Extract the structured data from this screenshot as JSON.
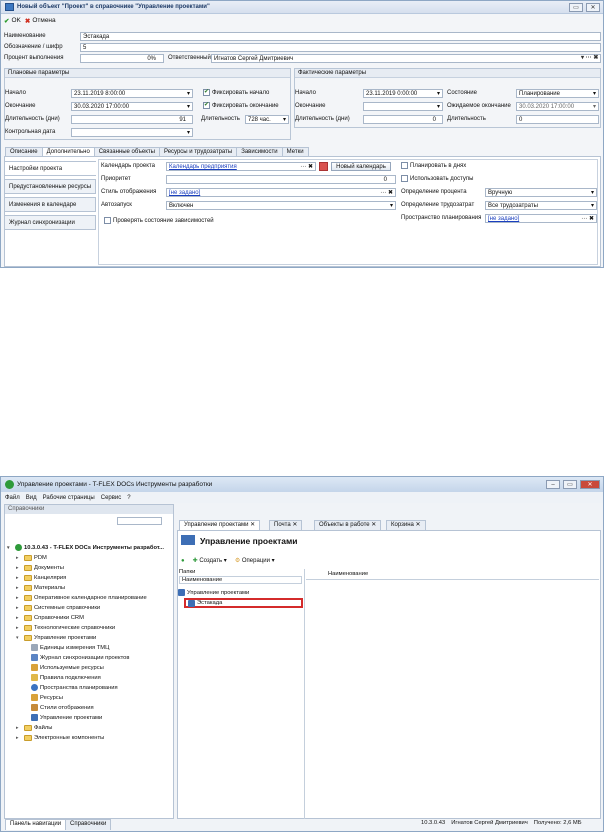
{
  "dialog": {
    "title": "Новый объект \"Проект\" в справочнике \"Управление проектами\"",
    "ok": "OK",
    "cancel": "Отмена",
    "name_label": "Наименование",
    "name_value": "Эстакада",
    "code_label": "Обозначение / шифр",
    "code_value": "5",
    "percent_label": "Процент выполнения",
    "percent_value": "0%",
    "resp_label": "Ответственный",
    "resp_value": "Игнатов Сергей Дмитриевич",
    "planned": {
      "title": "Плановые параметры",
      "start_label": "Начало",
      "start": "23.11.2019 8:00:00",
      "end_label": "Окончание",
      "end": "30.03.2020 17:00:00",
      "dur_label": "Длительность (дни)",
      "dur": "91",
      "ctrl_label": "Контрольная дата",
      "fix_start": "Фиксировать начало",
      "fix_end": "Фиксировать окончание",
      "len_label": "Длительность",
      "len": "728 час."
    },
    "actual": {
      "title": "Фактические параметры",
      "start_label": "Начало",
      "start": "23.11.2019 0:00:00",
      "end_label": "Окончание",
      "dur_label": "Длительность (дни)",
      "dur": "0",
      "state_label": "Состояние",
      "state": "Планирование",
      "exp_end_label": "Ожидаемое окончание",
      "exp_end": "30.03.2020 17:00:00",
      "len_label": "Длительность",
      "len": "0"
    },
    "tabs": [
      "Описание",
      "Дополнительно",
      "Связанные объекты",
      "Ресурсы и трудозатраты",
      "Зависимости",
      "Метки"
    ],
    "side": [
      "Настройки проекта",
      "Предустановленные ресурсы",
      "Изменения в календаре",
      "Журнал синхронизации"
    ],
    "extra": {
      "cal_label": "Календарь проекта",
      "cal": "Календарь предприятия",
      "new_cal": "Новый календарь",
      "prio_label": "Приоритет",
      "prio": "0",
      "style_label": "Стиль отображения",
      "style": "[не задано]",
      "auto_label": "Автозапуск",
      "auto": "Включен",
      "check_deps": "Проверять состояние зависимостей",
      "plan_days": "Планировать в днях",
      "use_access": "Использовать доступы",
      "pct_def_label": "Определение процента",
      "pct_def": "Вручную",
      "labor_def_label": "Определение трудозатрат",
      "labor_def": "Все трудозатраты",
      "space_label": "Пространство планирования",
      "space": "[не задано]"
    }
  },
  "app": {
    "title": "Управление проектами - T-FLEX DOCs Инструменты разработки",
    "menu": [
      "Файл",
      "Вид",
      "Рабочие страницы",
      "Сервис",
      "?"
    ],
    "panel_title": "Справочники",
    "tree_root": "10.3.0.43 - T-FLEX DOCs Инструменты разработ...",
    "tree": [
      "PDM",
      "Документы",
      "Канцелярия",
      "Материалы",
      "Оперативное календарное планирование",
      "Системные справочники",
      "Справочники CRM",
      "Технологические справочники",
      "Управление проектами"
    ],
    "sub": [
      "Единицы измерения ТМЦ",
      "Журнал синхронизации проектов",
      "Используемые ресурсы",
      "Правила подключения",
      "Пространства планирования",
      "Ресурсы",
      "Стили отображения",
      "Управление проектами"
    ],
    "tree_after": [
      "Файлы",
      "Электронные компоненты"
    ],
    "tabs": [
      "Управление проектами",
      "Почта",
      "Объекты в работе",
      "Корзина"
    ],
    "header": "Управление проектами",
    "create": "Создать",
    "ops": "Операции",
    "folders_label": "Папки",
    "col_name": "Наименование",
    "folder_root": "Управление проектами",
    "folder_item": "Эстакада",
    "bottom_tabs": [
      "Панель навигации",
      "Справочники"
    ],
    "status": [
      "10.3.0.43",
      "Игнатов Сергей Дмитриевич",
      "Получено: 2,6 МБ"
    ]
  }
}
